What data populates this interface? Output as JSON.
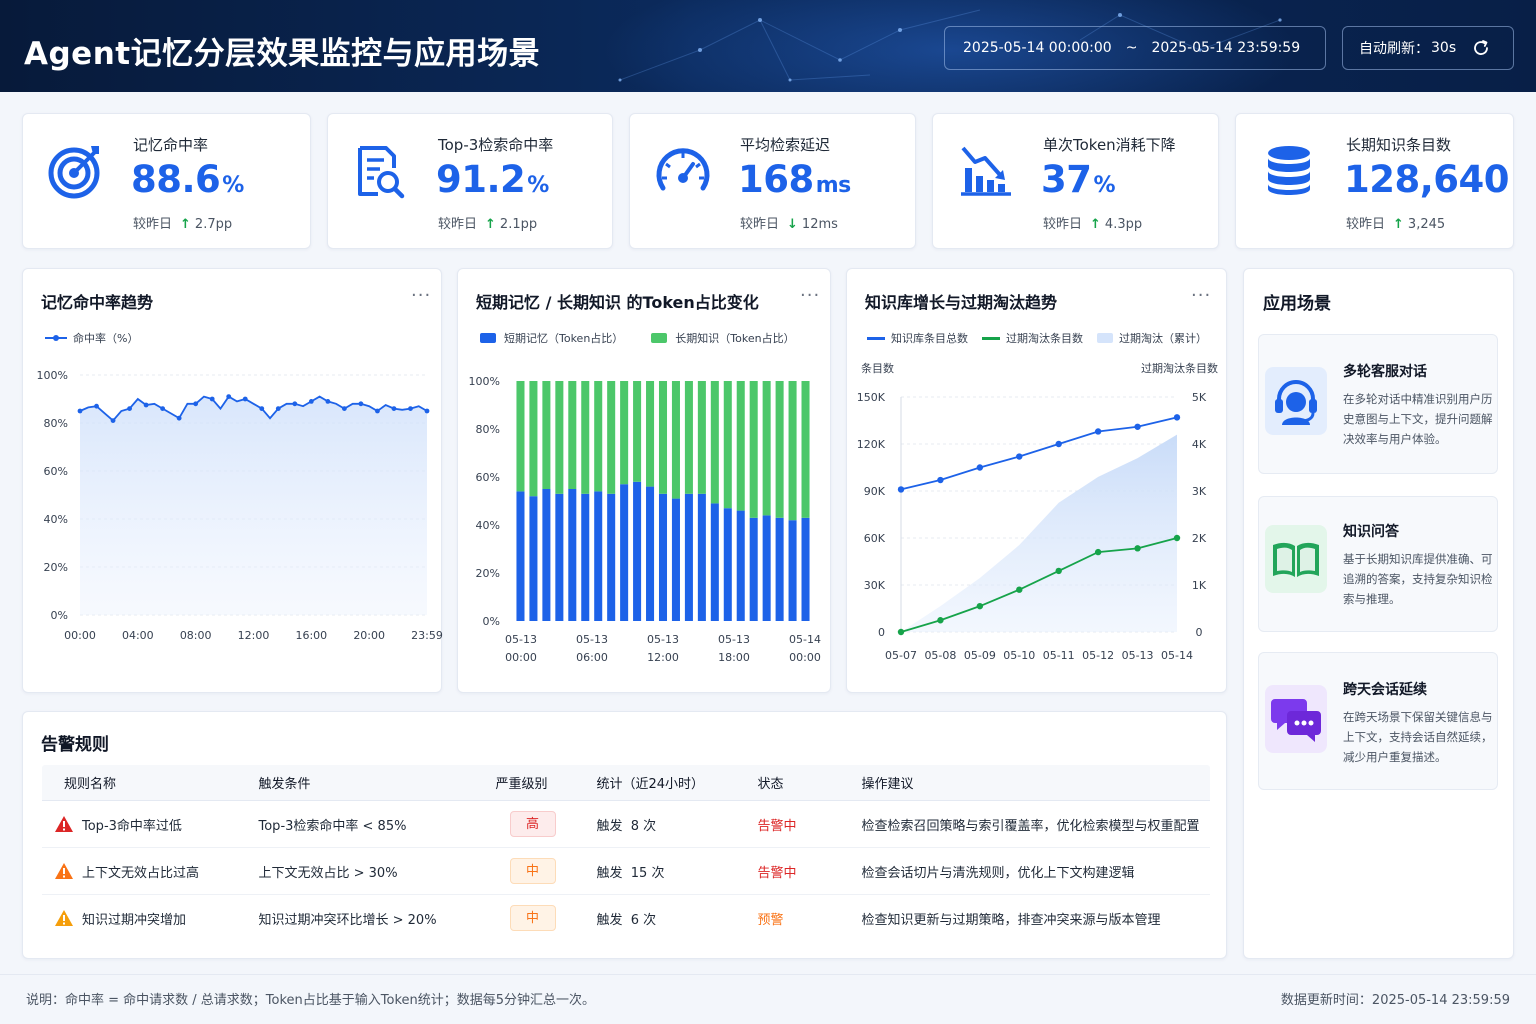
{
  "header": {
    "title": "Agent记忆分层效果监控与应用场景",
    "date_start": "2025-05-14 00:00:00",
    "date_sep": "~",
    "date_end": "2025-05-14 23:59:59",
    "auto_refresh_label": "自动刷新：",
    "auto_refresh_value": "30s"
  },
  "kpis": [
    {
      "icon": "target-icon",
      "label": "记忆命中率",
      "value": "88.6",
      "unit": "%",
      "compare_label": "较昨日",
      "trend": "up",
      "delta": "2.7pp"
    },
    {
      "icon": "search-document-icon",
      "label": "Top-3检索命中率",
      "value": "91.2",
      "unit": "%",
      "compare_label": "较昨日",
      "trend": "up",
      "delta": "2.1pp"
    },
    {
      "icon": "speedometer-icon",
      "label": "平均检索延迟",
      "value": "168",
      "unit": "ms",
      "compare_label": "较昨日",
      "trend": "down",
      "delta": "12ms"
    },
    {
      "icon": "bar-chart-down-icon",
      "label": "单次Token消耗下降",
      "value": "37",
      "unit": "%",
      "compare_label": "较昨日",
      "trend": "up",
      "delta": "4.3pp"
    },
    {
      "icon": "database-icon",
      "label": "长期知识条目数",
      "value": "128,640",
      "unit": "",
      "compare_label": "较昨日",
      "trend": "up",
      "delta": "3,245"
    }
  ],
  "colors": {
    "primary": "#1d62e8",
    "green": "#4cc76a",
    "line_green": "#16a34a",
    "danger": "#dc2626",
    "warn": "#f97316",
    "caution": "#f59e0b"
  },
  "hit_rate_panel": {
    "title": "记忆命中率趋势",
    "more": "···",
    "chart_data": {
      "type": "line",
      "series": [
        {
          "name": "命中率（%）",
          "values": [
            85,
            86.5,
            87,
            84,
            81,
            85,
            86,
            90,
            87.5,
            88,
            86,
            84,
            82,
            88,
            88,
            91,
            90,
            86,
            91,
            89,
            90,
            88,
            86,
            82,
            86,
            88,
            88,
            87,
            89,
            91,
            89,
            88,
            86,
            88,
            88,
            87,
            85,
            87.5,
            86,
            85.5,
            86,
            87,
            85
          ]
        }
      ],
      "x_ticks": [
        "00:00",
        "04:00",
        "08:00",
        "12:00",
        "16:00",
        "20:00",
        "23:59"
      ],
      "y_ticks": [
        "100%",
        "80%",
        "60%",
        "40%",
        "20%",
        "0%"
      ],
      "ylim": [
        0,
        100
      ],
      "grid": true,
      "legend": "top-left"
    }
  },
  "token_panel": {
    "title": "短期记忆 / 长期知识 的Token占比变化",
    "more": "···",
    "chart_data": {
      "type": "bar",
      "stacked": true,
      "series": [
        {
          "name": "短期记忆（Token占比）",
          "values": [
            54,
            52,
            55,
            53,
            55,
            53,
            54,
            53,
            57,
            58,
            56,
            53,
            51,
            53,
            53,
            49,
            47,
            46,
            43,
            44,
            43,
            42,
            43
          ]
        },
        {
          "name": "长期知识（Token占比）",
          "values": [
            46,
            48,
            45,
            47,
            45,
            47,
            46,
            47,
            43,
            42,
            44,
            47,
            49,
            47,
            47,
            51,
            53,
            54,
            57,
            56,
            57,
            58,
            57
          ]
        }
      ],
      "x_ticks": [
        [
          "05-13",
          "00:00"
        ],
        [
          "05-13",
          "06:00"
        ],
        [
          "05-13",
          "12:00"
        ],
        [
          "05-13",
          "18:00"
        ],
        [
          "05-14",
          "00:00"
        ]
      ],
      "y_ticks": [
        "100%",
        "80%",
        "60%",
        "40%",
        "20%",
        "0%"
      ],
      "ylim": [
        0,
        100
      ],
      "legend": "top"
    }
  },
  "kb_panel": {
    "title": "知识库增长与过期淘汰趋势",
    "more": "···",
    "y_left_label": "条目数",
    "y_right_label": "过期淘汰条目数",
    "chart_data": {
      "type": "line",
      "x": [
        "05-07",
        "05-08",
        "05-09",
        "05-10",
        "05-11",
        "05-12",
        "05-13",
        "05-14"
      ],
      "series": [
        {
          "name": "知识库条目总数",
          "axis": "left",
          "values": [
            91000,
            97000,
            105000,
            112000,
            120000,
            128000,
            131000,
            137000
          ]
        },
        {
          "name": "过期淘汰条目数",
          "axis": "right",
          "values": [
            0,
            250,
            550,
            900,
            1300,
            1700,
            1780,
            2000
          ]
        },
        {
          "name": "过期淘汰（累计）",
          "axis": "right",
          "type": "area",
          "values": [
            0,
            550,
            1150,
            1850,
            2750,
            3300,
            3700,
            4200
          ]
        }
      ],
      "y_left_ticks": [
        "150K",
        "120K",
        "90K",
        "60K",
        "30K",
        "0"
      ],
      "y_right_ticks": [
        "5K",
        "4K",
        "3K",
        "2K",
        "1K",
        "0"
      ],
      "ylim_left": [
        0,
        150000
      ],
      "ylim_right": [
        0,
        5000
      ],
      "grid": true,
      "legend": "top"
    }
  },
  "scenarios": {
    "title": "应用场景",
    "items": [
      {
        "icon": "headset-icon",
        "title": "多轮客服对话",
        "desc": "在多轮对话中精准识别用户历史意图与上下文，提升问题解决效率与用户体验。"
      },
      {
        "icon": "book-icon",
        "title": "知识问答",
        "desc": "基于长期知识库提供准确、可追溯的答案，支持复杂知识检索与推理。"
      },
      {
        "icon": "chat-bubbles-icon",
        "title": "跨天会话延续",
        "desc": "在跨天场景下保留关键信息与上下文，支持会话自然延续，减少用户重复描述。"
      }
    ]
  },
  "alerts": {
    "title": "告警规则",
    "columns": [
      "规则名称",
      "触发条件",
      "严重级别",
      "统计（近24小时）",
      "状态",
      "操作建议"
    ],
    "rows": [
      {
        "level": "danger",
        "name": "Top-3命中率过低",
        "condition": "Top-3检索命中率 < 85%",
        "severity": "高",
        "stat": "触发  8 次",
        "status": "告警中",
        "advice": "检查检索召回策略与索引覆盖率，优化检索模型与权重配置"
      },
      {
        "level": "warn",
        "name": "上下文无效占比过高",
        "condition": "上下文无效占比 > 30%",
        "severity": "中",
        "stat": "触发  15 次",
        "status": "告警中",
        "advice": "检查会话切片与清洗规则，优化上下文构建逻辑"
      },
      {
        "level": "caution",
        "name": "知识过期冲突增加",
        "condition": "知识过期冲突环比增长 > 20%",
        "severity": "中",
        "stat": "触发  6 次",
        "status": "预警",
        "advice": "检查知识更新与过期策略，排查冲突来源与版本管理"
      }
    ]
  },
  "footer": {
    "note": "说明：命中率 = 命中请求数 / 总请求数；Token占比基于输入Token统计；数据每5分钟汇总一次。",
    "updated": "数据更新时间：2025-05-14 23:59:59"
  }
}
